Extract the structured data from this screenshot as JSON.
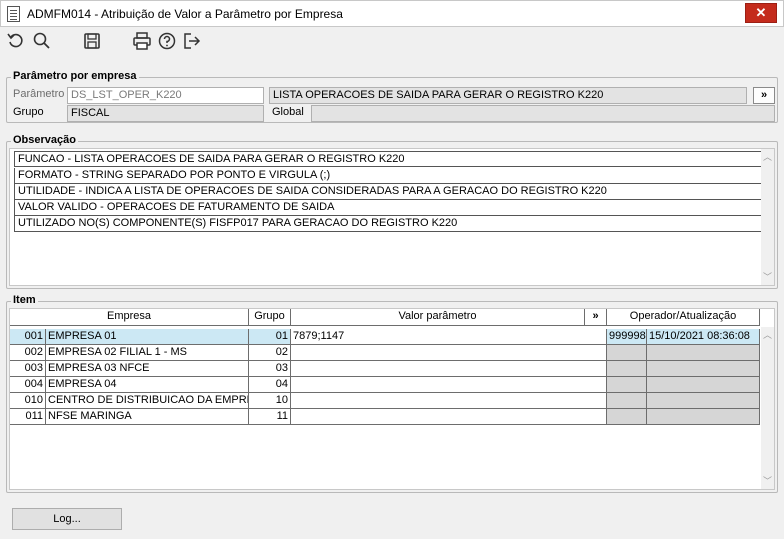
{
  "window": {
    "title": "ADMFM014 - Atribuição de Valor a Parâmetro por Empresa",
    "close_label": "✕"
  },
  "toolbar": {
    "icons": [
      "refresh-icon",
      "search-icon",
      "save-icon",
      "print-icon",
      "help-icon",
      "exit-icon"
    ]
  },
  "parametro_por_empresa": {
    "legend": "Parâmetro por empresa",
    "parametro_label": "Parâmetro",
    "parametro_value": "DS_LST_OPER_K220",
    "descricao_value": "LISTA OPERACOES DE SAIDA PARA GERAR O REGISTRO K220",
    "more_button": "»",
    "grupo_label": "Grupo",
    "grupo_value": "FISCAL",
    "global_label": "Global",
    "global_value": ""
  },
  "observacao": {
    "legend": "Observação",
    "lines": [
      "FUNCAO - LISTA OPERACOES DE SAIDA PARA GERAR O REGISTRO K220",
      "FORMATO - STRING SEPARADO POR PONTO E VIRGULA (;)",
      "UTILIDADE - INDICA A LISTA DE OPERACOES DE SAIDA CONSIDERADAS PARA A GERACAO DO REGISTRO K220",
      "VALOR VALIDO - OPERACOES DE FATURAMENTO DE SAIDA",
      "UTILIZADO NO(S) COMPONENTE(S) FISFP017 PARA  GERACAO DO REGISTRO K220"
    ]
  },
  "item": {
    "legend": "Item",
    "columns": {
      "empresa": "Empresa",
      "grupo": "Grupo",
      "valor": "Valor parâmetro",
      "more": "»",
      "operador": "Operador/Atualização"
    },
    "rows": [
      {
        "code": "001",
        "empresa": "EMPRESA 01",
        "grupo": "01",
        "valor": "7879;1147",
        "operador": "999998",
        "atualizacao": "15/10/2021 08:36:08"
      },
      {
        "code": "002",
        "empresa": "EMPRESA 02 FILIAL 1 - MS",
        "grupo": "02",
        "valor": "",
        "operador": "",
        "atualizacao": ""
      },
      {
        "code": "003",
        "empresa": "EMPRESA 03 NFCE",
        "grupo": "03",
        "valor": "",
        "operador": "",
        "atualizacao": ""
      },
      {
        "code": "004",
        "empresa": "EMPRESA 04",
        "grupo": "04",
        "valor": "",
        "operador": "",
        "atualizacao": ""
      },
      {
        "code": "010",
        "empresa": "CENTRO DE DISTRIBUICAO DA EMPRESA",
        "grupo": "10",
        "valor": "",
        "operador": "",
        "atualizacao": ""
      },
      {
        "code": "011",
        "empresa": "NFSE MARINGA",
        "grupo": "11",
        "valor": "",
        "operador": "",
        "atualizacao": ""
      }
    ]
  },
  "footer": {
    "log_button": "Log..."
  }
}
